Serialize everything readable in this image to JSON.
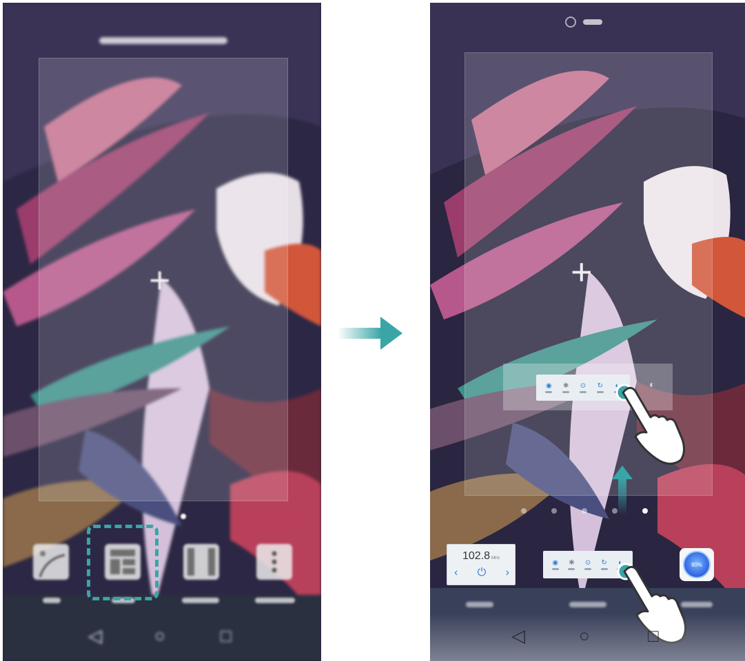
{
  "left_screen": {
    "mode": "home-screen-editing",
    "edit_menu": [
      {
        "name": "wallpaper-option",
        "icon": "wallpaper-icon"
      },
      {
        "name": "widgets-option",
        "icon": "widgets-icon",
        "highlighted": true
      },
      {
        "name": "transitions-option",
        "icon": "transition-icon"
      },
      {
        "name": "settings-option",
        "icon": "more-vertical-icon"
      }
    ],
    "navigation": [
      "back-icon",
      "home-icon",
      "recents-icon"
    ]
  },
  "transition": {
    "icon": "arrow-right-icon",
    "color": "#3aa5a6"
  },
  "right_screen": {
    "widgets": {
      "fm_radio": {
        "frequency": "102.8",
        "unit": "MHz",
        "icon": "fm-radio-icon"
      },
      "switch": {
        "icons": [
          "wifi-icon",
          "bluetooth-icon",
          "location-icon",
          "auto-rotate-icon",
          "brightness-icon"
        ]
      },
      "battery": {
        "percent_label": "80%",
        "level": 0.8
      }
    },
    "gesture": {
      "direction": "up",
      "color": "#3aa5a6"
    },
    "navigation": [
      "back-icon",
      "home-icon",
      "recents-icon"
    ]
  },
  "colors": {
    "accent": "#3aa5a6",
    "widget_icon": "#2e7fd6"
  }
}
